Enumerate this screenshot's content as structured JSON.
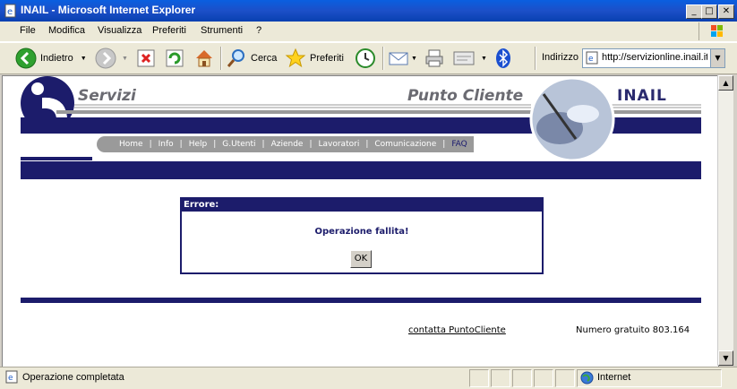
{
  "window": {
    "title": "INAIL - Microsoft Internet Explorer"
  },
  "menu": [
    "File",
    "Modifica",
    "Visualizza",
    "Preferiti",
    "Strumenti",
    "?"
  ],
  "toolbar": {
    "back_label": "Indietro",
    "search_label": "Cerca",
    "favorites_label": "Preferiti",
    "address_label": "Indirizzo",
    "address_value": "http://servizionline.inail.it"
  },
  "page": {
    "header": {
      "left": "Servizi",
      "center": "Punto Cliente",
      "brand": "INAIL"
    },
    "nav": [
      "Home",
      "Info",
      "Help",
      "G.Utenti",
      "Aziende",
      "Lavoratori",
      "Comunicazione",
      "FAQ"
    ],
    "dialog": {
      "title": "Errore:",
      "message": "Operazione fallita!",
      "ok_label": "OK"
    },
    "footer": {
      "link": "contatta PuntoCliente",
      "phone": "Numero gratuito 803.164"
    }
  },
  "status": {
    "text": "Operazione completata",
    "zone": "Internet"
  }
}
